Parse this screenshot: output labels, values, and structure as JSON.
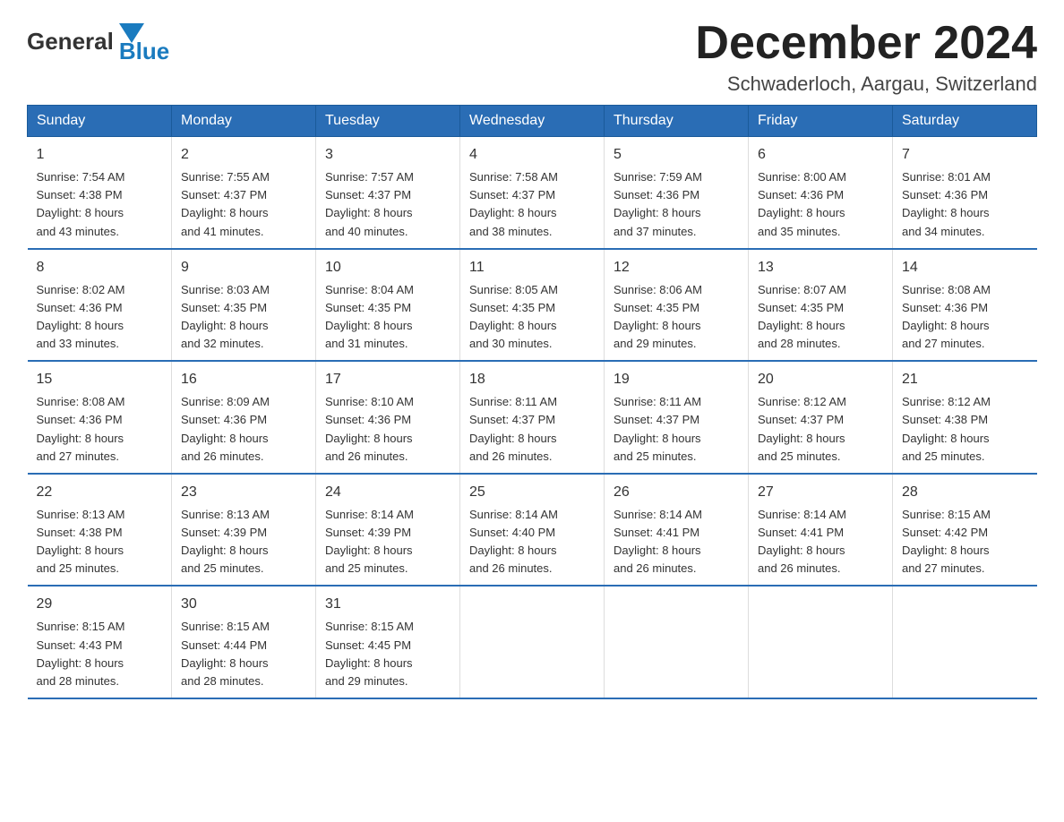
{
  "logo": {
    "general": "General",
    "blue": "Blue"
  },
  "title": "December 2024",
  "subtitle": "Schwaderloch, Aargau, Switzerland",
  "weekdays": [
    "Sunday",
    "Monday",
    "Tuesday",
    "Wednesday",
    "Thursday",
    "Friday",
    "Saturday"
  ],
  "weeks": [
    [
      {
        "day": "1",
        "sunrise": "7:54 AM",
        "sunset": "4:38 PM",
        "daylight": "8 hours and 43 minutes."
      },
      {
        "day": "2",
        "sunrise": "7:55 AM",
        "sunset": "4:37 PM",
        "daylight": "8 hours and 41 minutes."
      },
      {
        "day": "3",
        "sunrise": "7:57 AM",
        "sunset": "4:37 PM",
        "daylight": "8 hours and 40 minutes."
      },
      {
        "day": "4",
        "sunrise": "7:58 AM",
        "sunset": "4:37 PM",
        "daylight": "8 hours and 38 minutes."
      },
      {
        "day": "5",
        "sunrise": "7:59 AM",
        "sunset": "4:36 PM",
        "daylight": "8 hours and 37 minutes."
      },
      {
        "day": "6",
        "sunrise": "8:00 AM",
        "sunset": "4:36 PM",
        "daylight": "8 hours and 35 minutes."
      },
      {
        "day": "7",
        "sunrise": "8:01 AM",
        "sunset": "4:36 PM",
        "daylight": "8 hours and 34 minutes."
      }
    ],
    [
      {
        "day": "8",
        "sunrise": "8:02 AM",
        "sunset": "4:36 PM",
        "daylight": "8 hours and 33 minutes."
      },
      {
        "day": "9",
        "sunrise": "8:03 AM",
        "sunset": "4:35 PM",
        "daylight": "8 hours and 32 minutes."
      },
      {
        "day": "10",
        "sunrise": "8:04 AM",
        "sunset": "4:35 PM",
        "daylight": "8 hours and 31 minutes."
      },
      {
        "day": "11",
        "sunrise": "8:05 AM",
        "sunset": "4:35 PM",
        "daylight": "8 hours and 30 minutes."
      },
      {
        "day": "12",
        "sunrise": "8:06 AM",
        "sunset": "4:35 PM",
        "daylight": "8 hours and 29 minutes."
      },
      {
        "day": "13",
        "sunrise": "8:07 AM",
        "sunset": "4:35 PM",
        "daylight": "8 hours and 28 minutes."
      },
      {
        "day": "14",
        "sunrise": "8:08 AM",
        "sunset": "4:36 PM",
        "daylight": "8 hours and 27 minutes."
      }
    ],
    [
      {
        "day": "15",
        "sunrise": "8:08 AM",
        "sunset": "4:36 PM",
        "daylight": "8 hours and 27 minutes."
      },
      {
        "day": "16",
        "sunrise": "8:09 AM",
        "sunset": "4:36 PM",
        "daylight": "8 hours and 26 minutes."
      },
      {
        "day": "17",
        "sunrise": "8:10 AM",
        "sunset": "4:36 PM",
        "daylight": "8 hours and 26 minutes."
      },
      {
        "day": "18",
        "sunrise": "8:11 AM",
        "sunset": "4:37 PM",
        "daylight": "8 hours and 26 minutes."
      },
      {
        "day": "19",
        "sunrise": "8:11 AM",
        "sunset": "4:37 PM",
        "daylight": "8 hours and 25 minutes."
      },
      {
        "day": "20",
        "sunrise": "8:12 AM",
        "sunset": "4:37 PM",
        "daylight": "8 hours and 25 minutes."
      },
      {
        "day": "21",
        "sunrise": "8:12 AM",
        "sunset": "4:38 PM",
        "daylight": "8 hours and 25 minutes."
      }
    ],
    [
      {
        "day": "22",
        "sunrise": "8:13 AM",
        "sunset": "4:38 PM",
        "daylight": "8 hours and 25 minutes."
      },
      {
        "day": "23",
        "sunrise": "8:13 AM",
        "sunset": "4:39 PM",
        "daylight": "8 hours and 25 minutes."
      },
      {
        "day": "24",
        "sunrise": "8:14 AM",
        "sunset": "4:39 PM",
        "daylight": "8 hours and 25 minutes."
      },
      {
        "day": "25",
        "sunrise": "8:14 AM",
        "sunset": "4:40 PM",
        "daylight": "8 hours and 26 minutes."
      },
      {
        "day": "26",
        "sunrise": "8:14 AM",
        "sunset": "4:41 PM",
        "daylight": "8 hours and 26 minutes."
      },
      {
        "day": "27",
        "sunrise": "8:14 AM",
        "sunset": "4:41 PM",
        "daylight": "8 hours and 26 minutes."
      },
      {
        "day": "28",
        "sunrise": "8:15 AM",
        "sunset": "4:42 PM",
        "daylight": "8 hours and 27 minutes."
      }
    ],
    [
      {
        "day": "29",
        "sunrise": "8:15 AM",
        "sunset": "4:43 PM",
        "daylight": "8 hours and 28 minutes."
      },
      {
        "day": "30",
        "sunrise": "8:15 AM",
        "sunset": "4:44 PM",
        "daylight": "8 hours and 28 minutes."
      },
      {
        "day": "31",
        "sunrise": "8:15 AM",
        "sunset": "4:45 PM",
        "daylight": "8 hours and 29 minutes."
      },
      null,
      null,
      null,
      null
    ]
  ],
  "labels": {
    "sunrise": "Sunrise:",
    "sunset": "Sunset:",
    "daylight": "Daylight:"
  }
}
